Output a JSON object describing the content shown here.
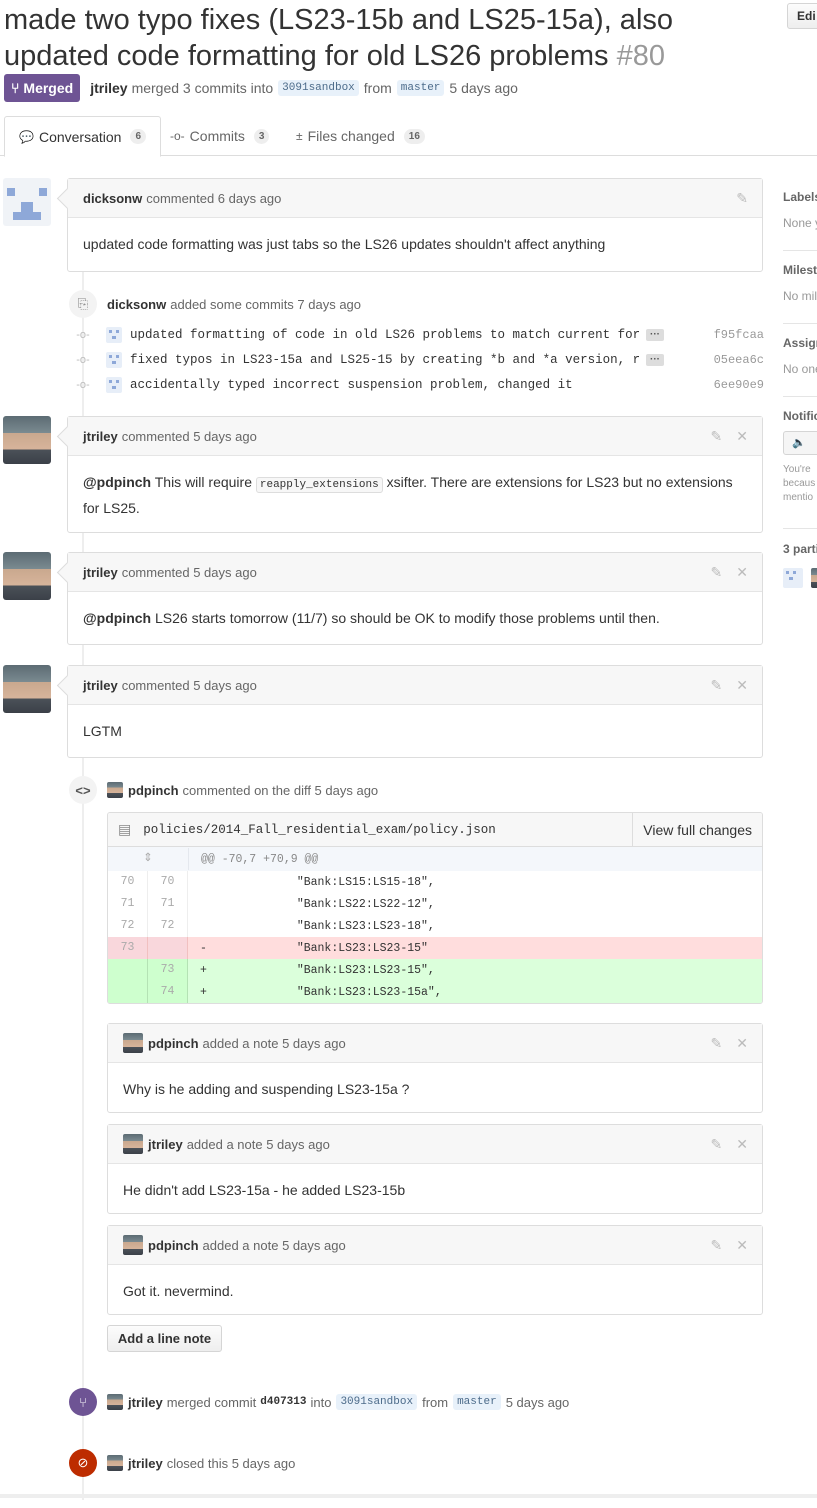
{
  "header": {
    "title": "made two typo fixes (LS23-15b and LS25-15a), also updated code formatting for old LS26 problems",
    "number": "#80",
    "edit_label": "Edi",
    "state": "Merged",
    "author": "jtriley",
    "merged_text": "merged 3 commits into",
    "base_branch": "3091sandbox",
    "from_text": "from",
    "head_branch": "master",
    "time": "5 days ago"
  },
  "tabs": [
    {
      "label": "Conversation",
      "count": "6"
    },
    {
      "label": "Commits",
      "count": "3"
    },
    {
      "label": "Files changed",
      "count": "16"
    }
  ],
  "comments": {
    "c1": {
      "author": "dicksonw",
      "action": "commented 6 days ago",
      "body": "updated code formatting was just tabs so the LS26 updates shouldn't affect anything"
    },
    "commits_event": {
      "author": "dicksonw",
      "action": "added some commits 7 days ago"
    },
    "commits": [
      {
        "message": "updated formatting of code in old LS26 problems to match current form…",
        "sha": "f95fcaa",
        "has_more": true
      },
      {
        "message": "fixed typos in LS23-15a and LS25-15 by creating *b and *a version, re…",
        "sha": "05eea6c",
        "has_more": true
      },
      {
        "message": "accidentally typed incorrect suspension problem, changed it",
        "sha": "6ee90e9",
        "has_more": false
      }
    ],
    "c2": {
      "author": "jtriley",
      "action": "commented 5 days ago",
      "mention": "@pdpinch",
      "text_before": "This will require",
      "code": "reapply_extensions",
      "text_after": "xsifter. There are extensions for LS23 but no extensions for LS25."
    },
    "c3": {
      "author": "jtriley",
      "action": "commented 5 days ago",
      "mention": "@pdpinch",
      "text": "LS26 starts tomorrow (11/7) so should be OK to modify those problems until then."
    },
    "c4": {
      "author": "jtriley",
      "action": "commented 5 days ago",
      "body": "LGTM"
    },
    "diff_event": {
      "author": "pdpinch",
      "action": "commented on the diff 5 days ago"
    }
  },
  "diff": {
    "path": "policies/2014_Fall_residential_exam/policy.json",
    "view_full_label": "View full changes",
    "hunk": "@@ -70,7 +70,9 @@",
    "lines": [
      {
        "old": "70",
        "new": "70",
        "sign": " ",
        "code": "            \"Bank:LS15:LS15-18\",",
        "type": "ctx"
      },
      {
        "old": "71",
        "new": "71",
        "sign": " ",
        "code": "            \"Bank:LS22:LS22-12\",",
        "type": "ctx"
      },
      {
        "old": "72",
        "new": "72",
        "sign": " ",
        "code": "            \"Bank:LS23:LS23-18\",",
        "type": "ctx"
      },
      {
        "old": "73",
        "new": "",
        "sign": "-",
        "code": "            \"Bank:LS23:LS23-15\"",
        "type": "del"
      },
      {
        "old": "",
        "new": "73",
        "sign": "+",
        "code": "            \"Bank:LS23:LS23-15\",",
        "type": "add"
      },
      {
        "old": "",
        "new": "74",
        "sign": "+",
        "code": "            \"Bank:LS23:LS23-15a\",",
        "type": "add"
      }
    ]
  },
  "notes": [
    {
      "author": "pdpinch",
      "action": "added a note 5 days ago",
      "body": "Why is he adding and suspending LS23-15a ?"
    },
    {
      "author": "jtriley",
      "action": "added a note 5 days ago",
      "body": "He didn't add LS23-15a - he added LS23-15b"
    },
    {
      "author": "pdpinch",
      "action": "added a note 5 days ago",
      "body": "Got it. nevermind."
    }
  ],
  "add_line_note_label": "Add a line note",
  "merge_event": {
    "author": "jtriley",
    "text1": "merged commit",
    "sha": "d407313",
    "text2": "into",
    "base": "3091sandbox",
    "text3": "from",
    "head": "master",
    "time": "5 days ago"
  },
  "close_event": {
    "author": "jtriley",
    "text": "closed this 5 days ago"
  },
  "sidebar": {
    "labels_title": "Labels",
    "labels_value": "None y",
    "milestone_title": "Milest",
    "milestone_value": "No mil",
    "assignee_title": "Assign",
    "assignee_value": "No one",
    "notifications_title": "Notific",
    "notif_line1": "You're",
    "notif_line2": "becaus",
    "notif_line3": "mentio",
    "participants_title": "3 parti"
  },
  "colors": {
    "merged": "#6e5494",
    "closed": "#bd2c00",
    "link": "#4183c4"
  }
}
